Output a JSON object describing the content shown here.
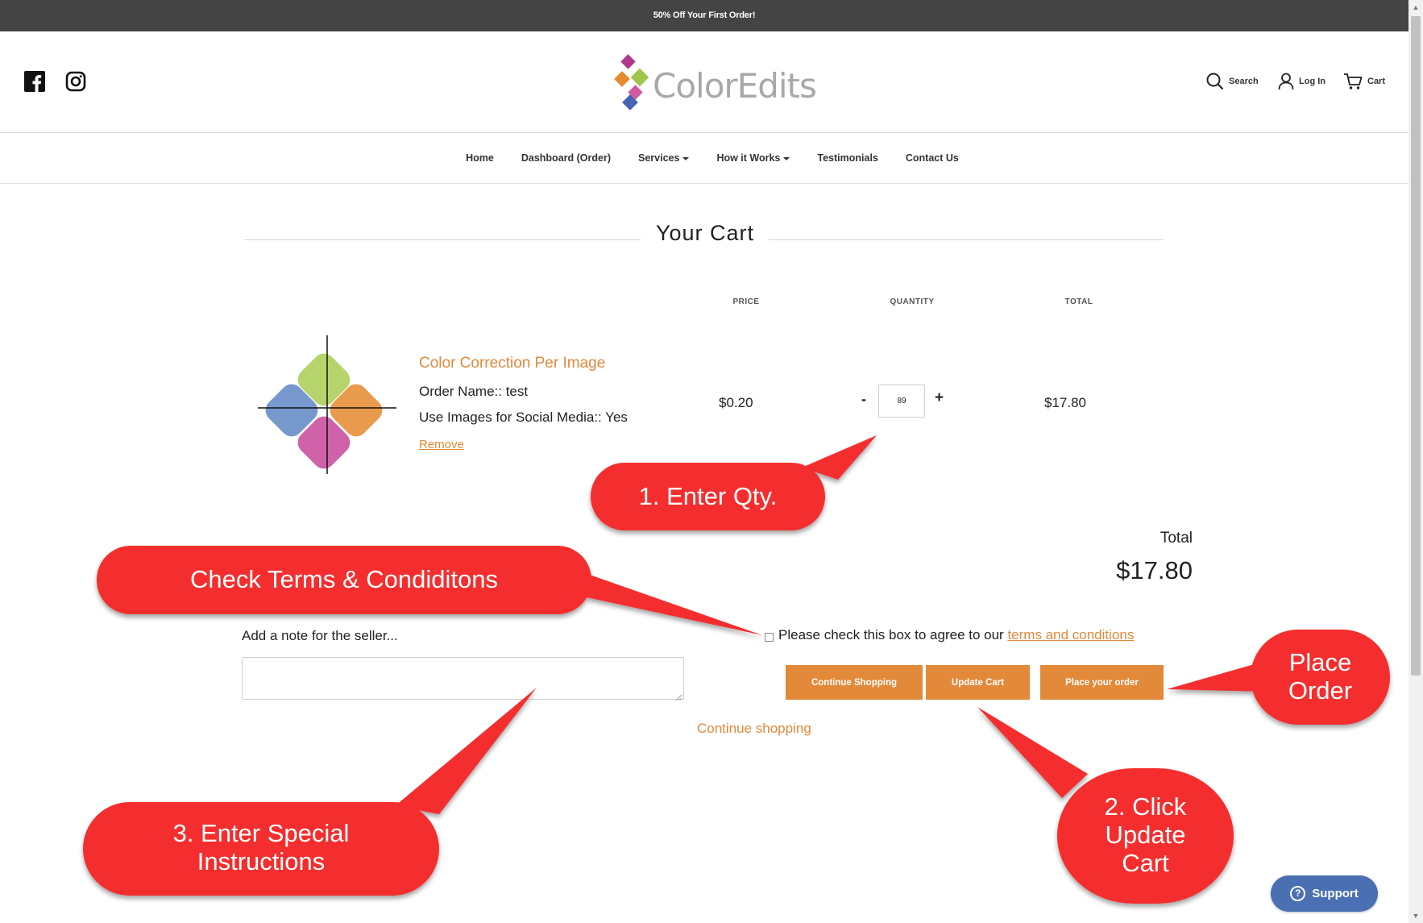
{
  "announcement": "50% Off Your First Order!",
  "header": {
    "logo_text": "ColorEdits",
    "search_label": "Search",
    "login_label": "Log In",
    "cart_label": "Cart"
  },
  "nav": {
    "items": [
      {
        "label": "Home",
        "dropdown": false
      },
      {
        "label": "Dashboard (Order)",
        "dropdown": false
      },
      {
        "label": "Services",
        "dropdown": true
      },
      {
        "label": "How it Works",
        "dropdown": true
      },
      {
        "label": "Testimonials",
        "dropdown": false
      },
      {
        "label": "Contact Us",
        "dropdown": false
      }
    ]
  },
  "cart": {
    "title": "Your Cart",
    "columns": {
      "price": "PRICE",
      "quantity": "QUANTITY",
      "total": "TOTAL"
    },
    "item": {
      "name": "Color Correction Per Image",
      "order_name": "Order Name:: test",
      "social_media": "Use Images for Social Media:: Yes",
      "remove_label": "Remove",
      "price": "$0.20",
      "quantity": "89",
      "qty_minus": "-",
      "qty_plus": "+",
      "line_total": "$17.80"
    },
    "total_label": "Total",
    "total_value": "$17.80",
    "note_label": "Add a note for the seller...",
    "terms_prefix": "Please check this box to agree to our ",
    "terms_link": "terms and conditions",
    "terms_checked": false,
    "buttons": {
      "continue_shopping": "Continue Shopping",
      "update_cart": "Update Cart",
      "place_order": "Place your order"
    },
    "continue_link": "Continue shopping"
  },
  "callouts": {
    "enter_qty": "1. Enter Qty.",
    "check_terms": "Check Terms & Condiditons",
    "special_line1": "3. Enter Special",
    "special_line2": "Instructions",
    "update_line1": "2. Click",
    "update_line2": "Update",
    "update_line3": "Cart",
    "place_line1": "Place",
    "place_line2": "Order",
    "color": "#f42f2f"
  },
  "support_label": "Support",
  "colors": {
    "accent": "#e2893a",
    "announcement_bg": "#444444",
    "support_bg": "#4a6fb3"
  }
}
